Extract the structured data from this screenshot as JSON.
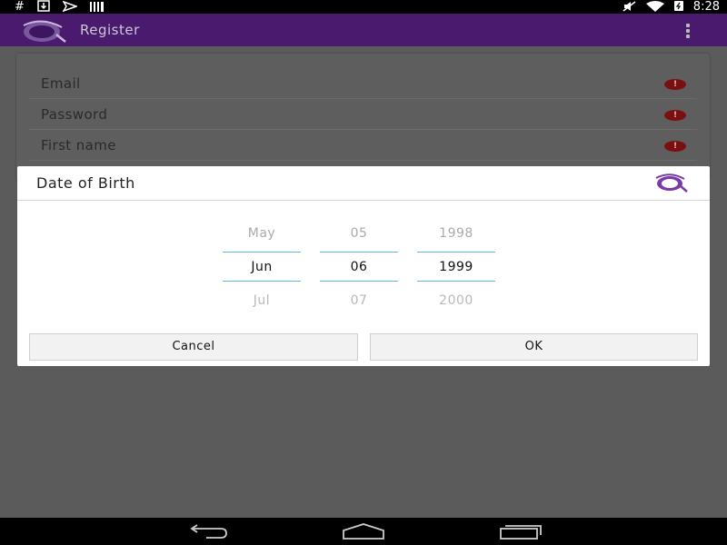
{
  "status_bar": {
    "icons": [
      "hash-icon",
      "download-icon",
      "send-icon",
      "barcode-icon",
      "mute-icon",
      "wifi-icon",
      "battery-icon"
    ],
    "time": "8:28"
  },
  "app_bar": {
    "title": "Register",
    "color": "#4a1a6e"
  },
  "form": {
    "fields": [
      {
        "label": "Email",
        "error_icon": "error-icon"
      },
      {
        "label": "Password",
        "error_icon": "error-icon"
      },
      {
        "label": "First name",
        "error_icon": "error-icon"
      }
    ]
  },
  "dialog": {
    "title": "Date of Birth",
    "picker": {
      "month": {
        "prev": "May",
        "current": "Jun",
        "next": "Jul"
      },
      "day": {
        "prev": "05",
        "current": "06",
        "next": "07"
      },
      "year": {
        "prev": "1998",
        "current": "1999",
        "next": "2000"
      }
    },
    "cancel_label": "Cancel",
    "ok_label": "OK",
    "accent_color": "#5bbcd6"
  },
  "nav_bar": {
    "icons": [
      "back-icon",
      "home-icon",
      "recents-icon"
    ]
  }
}
